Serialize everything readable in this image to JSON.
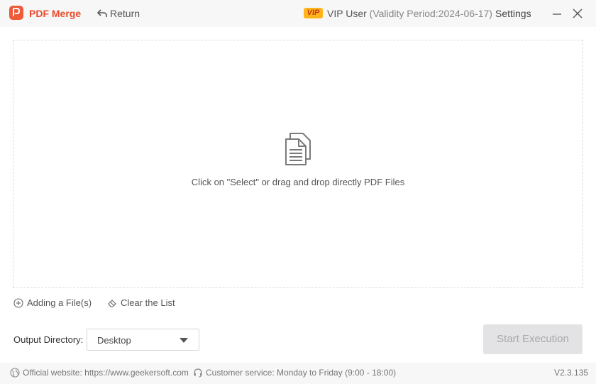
{
  "header": {
    "app_title": "PDF Merge",
    "return_label": "Return",
    "vip_badge": "VIP",
    "vip_user": "VIP User",
    "vip_validity": "(Validity Period:2024-06-17)",
    "settings_label": "Settings"
  },
  "dropzone": {
    "hint": "Click on \"Select\" or drag and drop directly PDF Files",
    "icon": "document-stack-icon"
  },
  "actions": {
    "add_files": "Adding a File(s)",
    "clear_list": "Clear the List"
  },
  "output": {
    "label": "Output Directory:",
    "selected": "Desktop"
  },
  "start_button": "Start Execution",
  "footer": {
    "website": "Official website: https://www.geekersoft.com",
    "service": "Customer service: Monday to Friday (9:00 - 18:00)",
    "version": "V2.3.135"
  },
  "colors": {
    "brand": "#e84c2b",
    "vip_badge": "#ffb51a",
    "button_disabled": "#e3e3e5"
  }
}
